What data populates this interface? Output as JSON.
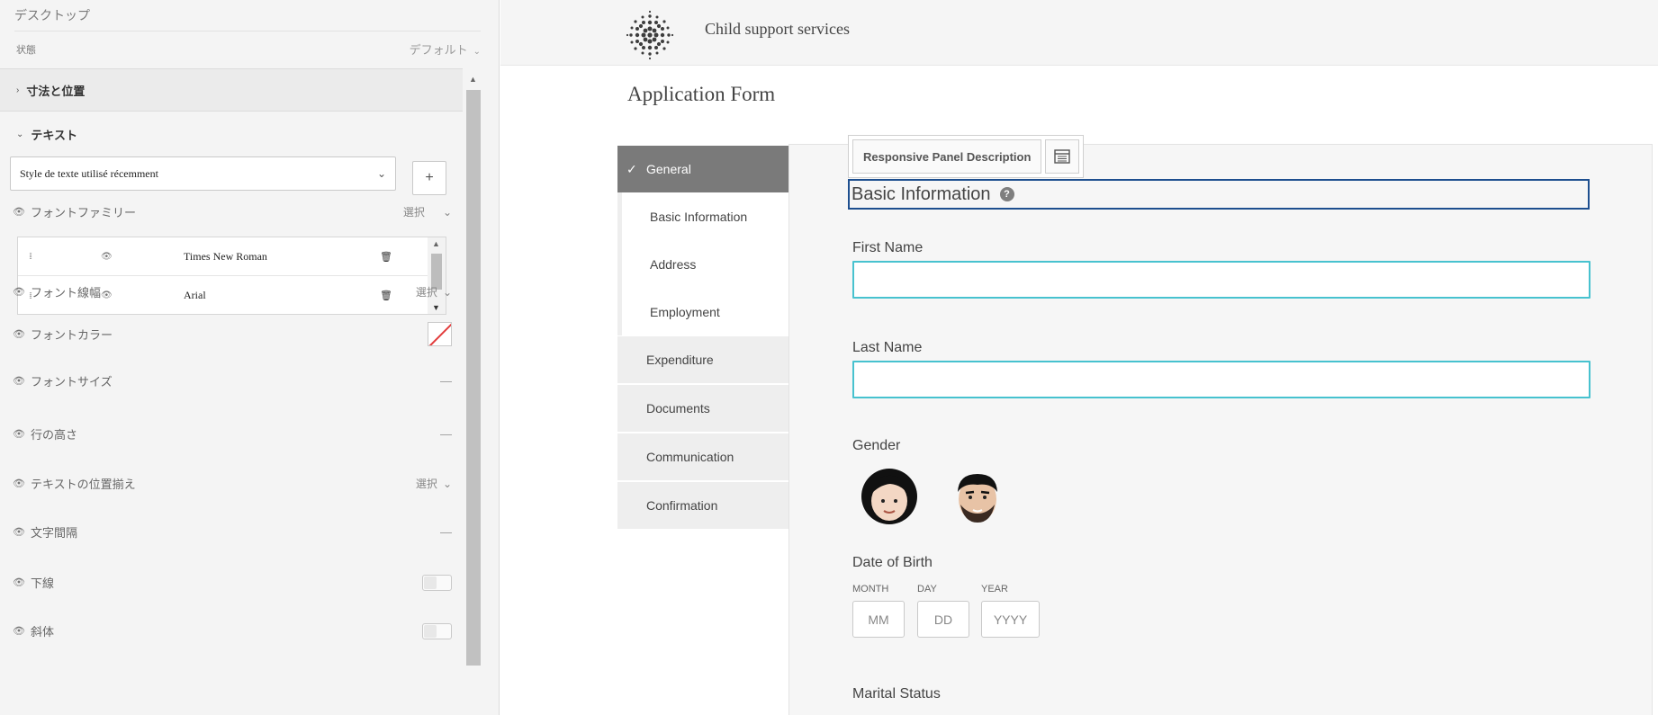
{
  "left_panel": {
    "header": "デスクトップ",
    "state_label": "状態",
    "state_value": "デフォルト",
    "section_size_position": "寸法と位置",
    "section_text": "テキスト",
    "text_style_select": "Style de texte utilisé récemment",
    "add_button": "+",
    "font_family": {
      "label": "フォントファミリー",
      "value": "選択",
      "fonts": [
        {
          "name": "Times New Roman"
        },
        {
          "name": "Arial"
        }
      ]
    },
    "font_weight": {
      "label": "フォント線幅",
      "value": "選択"
    },
    "font_color": {
      "label": "フォントカラー"
    },
    "font_size": {
      "label": "フォントサイズ",
      "value": "—"
    },
    "line_height": {
      "label": "行の高さ",
      "value": "—"
    },
    "text_align": {
      "label": "テキストの位置揃え",
      "value": "選択"
    },
    "letter_spacing": {
      "label": "文字間隔",
      "value": "—"
    },
    "underline": {
      "label": "下線"
    },
    "italic": {
      "label": "斜体"
    }
  },
  "preview": {
    "site_title": "Child support services",
    "form_title": "Application Form",
    "nav": {
      "general": "General",
      "basic_information": "Basic Information",
      "address": "Address",
      "employment": "Employment",
      "expenditure": "Expenditure",
      "documents": "Documents",
      "communication": "Communication",
      "confirmation": "Confirmation"
    },
    "responsive_panel_label": "Responsive Panel Description",
    "panel_title": "Basic Information",
    "help_glyph": "?",
    "first_name_label": "First Name",
    "last_name_label": "Last Name",
    "gender_label": "Gender",
    "dob_label": "Date of Birth",
    "dob": {
      "month_label": "MONTH",
      "day_label": "DAY",
      "year_label": "YEAR",
      "month_placeholder": "MM",
      "day_placeholder": "DD",
      "year_placeholder": "YYYY"
    },
    "marital_status_label": "Marital Status"
  }
}
